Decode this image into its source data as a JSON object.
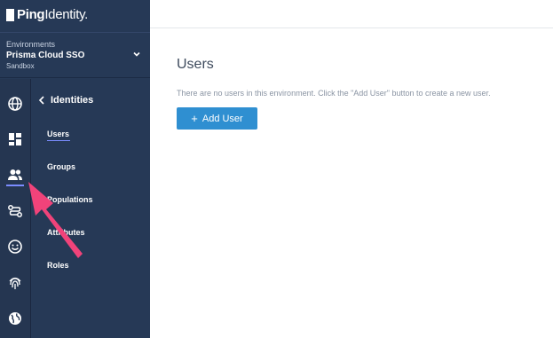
{
  "brand": {
    "name_bold": "Ping",
    "name_light": "Identity."
  },
  "environment": {
    "label": "Environments",
    "name": "Prisma Cloud SSO",
    "type": "Sandbox"
  },
  "rail": {
    "icons": [
      "globe-icon",
      "dashboard-icon",
      "users-icon",
      "connections-icon",
      "experiences-icon",
      "fingerprint-icon",
      "world-icon"
    ],
    "active": "users-icon"
  },
  "subnav": {
    "header": "Identities",
    "items": [
      {
        "label": "Users",
        "active": true
      },
      {
        "label": "Groups"
      },
      {
        "label": "Populations"
      },
      {
        "label": "Attributes"
      },
      {
        "label": "Roles"
      }
    ]
  },
  "main": {
    "title": "Users",
    "empty_message": "There are no users in this environment. Click the \"Add User\" button to create a new user.",
    "add_button_label": "Add User"
  },
  "colors": {
    "sidebar": "#263956",
    "accent": "#7b8cff",
    "button": "#2f8fd1",
    "annotation_arrow": "#f0437a"
  }
}
